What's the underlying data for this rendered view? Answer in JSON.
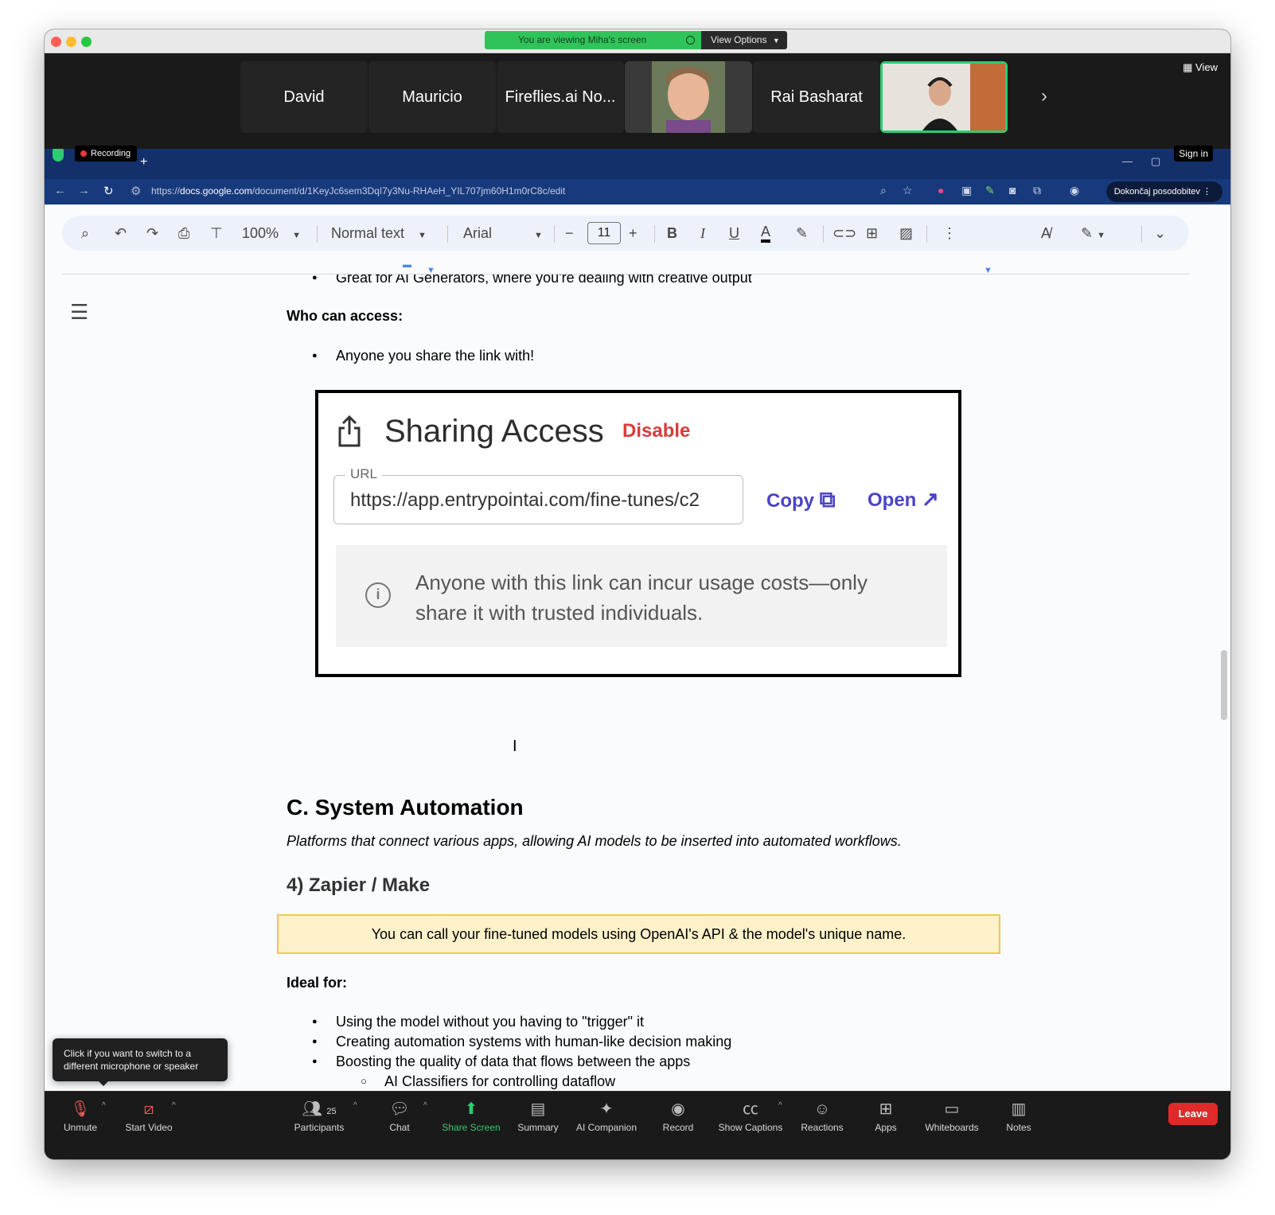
{
  "zoom_banner": {
    "viewing_text": "You are viewing Miha's screen",
    "view_options_label": "View Options"
  },
  "gallery": {
    "tiles": [
      {
        "name": "David"
      },
      {
        "name": "Mauricio"
      },
      {
        "name": "Fireflies.ai No..."
      },
      {
        "name": ""
      },
      {
        "name": "Rai Basharat"
      },
      {
        "name": ""
      }
    ],
    "view_label": "View"
  },
  "browser": {
    "recording_label": "Recording",
    "sign_in_label": "Sign in",
    "url_prefix": "https://",
    "url_host": "docs.google.com",
    "url_path": "/document/d/1KeyJc6sem3DqI7y3Nu-RHAeH_YIL707jm60H1m0rC8c/edit",
    "update_button_label": "Dokončaj posodobitev"
  },
  "docs_toolbar": {
    "zoom": "100%",
    "style": "Normal text",
    "font": "Arial",
    "font_size": "11"
  },
  "document": {
    "bullet_top": "Great for AI Generators, where you're dealing with creative output",
    "who_can_access_label": "Who can access:",
    "who_can_access_item": "Anyone you share the link with!",
    "sharing_card": {
      "title": "Sharing Access",
      "disable": "Disable",
      "url_label": "URL",
      "url_value": "https://app.entrypointai.com/fine-tunes/c2",
      "copy": "Copy",
      "open": "Open",
      "warning": "Anyone with this link can incur usage costs—only share it with trusted individuals."
    },
    "section_heading": "C. System Automation",
    "section_description": "Platforms that connect various apps, allowing AI models to be inserted into automated workflows.",
    "subheading": "4) Zapier / Make",
    "callout": "You can call your fine-tuned models using OpenAI's API & the model's unique name.",
    "ideal_for_label": "Ideal for:",
    "ideal_for_items": [
      "Using the model without you having to \"trigger\" it",
      "Creating automation systems with human-like decision making",
      "Boosting the quality of data that flows between the apps"
    ],
    "sub_item": "AI Classifiers for controlling dataflow"
  },
  "tooltip": {
    "text": "Click if you want to switch to a different microphone or speaker"
  },
  "meeting_controls": {
    "unmute": "Unmute",
    "start_video": "Start Video",
    "participants": "Participants",
    "participant_count": "25",
    "chat": "Chat",
    "share_screen": "Share Screen",
    "summary": "Summary",
    "ai_companion": "AI Companion",
    "record": "Record",
    "show_captions": "Show Captions",
    "reactions": "Reactions",
    "apps": "Apps",
    "whiteboards": "Whiteboards",
    "notes": "Notes",
    "leave": "Leave"
  },
  "colors": {
    "zoom_green": "#30c35a",
    "browser_dark_blue": "#13306b",
    "leave_red": "#e02a2a",
    "callout_fill": "#fdf1c9",
    "link_purple": "#4a43c8",
    "disable_red": "#d93b3b"
  }
}
